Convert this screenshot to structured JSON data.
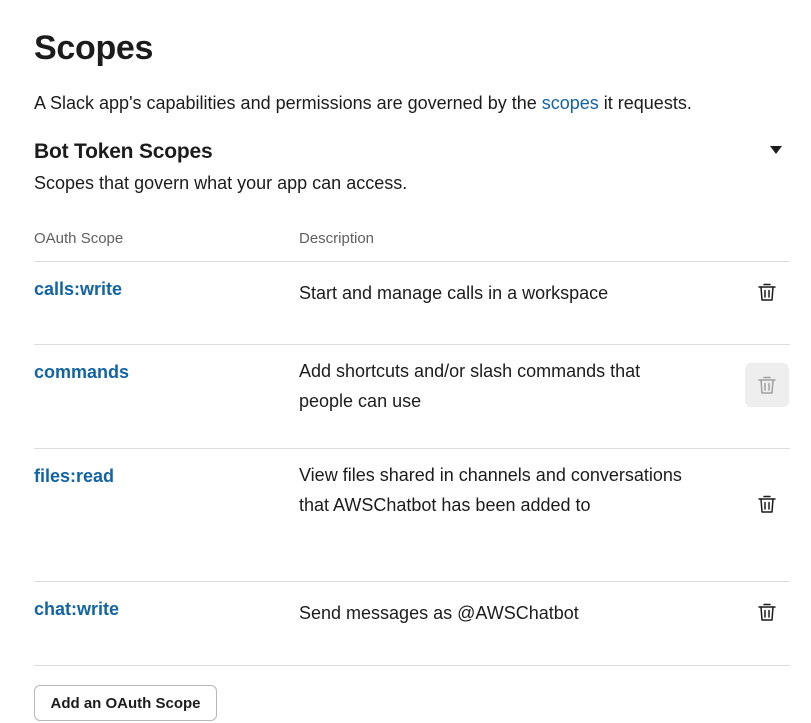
{
  "page": {
    "title": "Scopes",
    "intro_before": "A Slack app's capabilities and permissions are governed by the ",
    "intro_link": "scopes",
    "intro_after": " it requests."
  },
  "section": {
    "title": "Bot Token Scopes",
    "subtitle": "Scopes that govern what your app can access.",
    "toggle_icon": "caret-down-icon"
  },
  "table": {
    "columns": [
      "OAuth Scope",
      "Description"
    ],
    "rows": [
      {
        "scope": "calls:write",
        "description": "Start and manage calls in a workspace",
        "action_icon": "trash-icon"
      },
      {
        "scope": "commands",
        "description": "Add shortcuts and/or slash commands that people can use",
        "action_icon": "trash-icon"
      },
      {
        "scope": "files:read",
        "description": "View files shared in channels and conversations that AWSChatbot has been added to",
        "action_icon": "trash-icon"
      },
      {
        "scope": "chat:write",
        "description": "Send messages as @AWSChatbot",
        "action_icon": "trash-icon"
      }
    ]
  },
  "actions": {
    "add_scope_label": "Add an OAuth Scope"
  },
  "colors": {
    "link": "#1264a3",
    "text": "#1d1c1d",
    "muted": "#616061",
    "divider": "#dddddd"
  }
}
